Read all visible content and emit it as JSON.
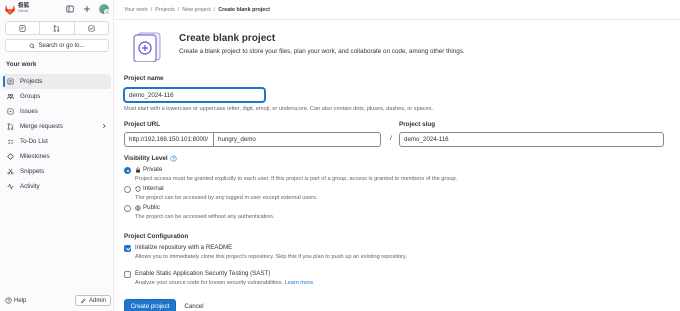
{
  "sidebar": {
    "logo_text": "极狐",
    "logo_subtext": "GitLab",
    "search_label": "Search or go to...",
    "section_title": "Your work",
    "items": [
      {
        "label": "Projects",
        "icon": "project-icon",
        "active": true
      },
      {
        "label": "Groups",
        "icon": "group-icon"
      },
      {
        "label": "Issues",
        "icon": "issues-icon"
      },
      {
        "label": "Merge requests",
        "icon": "merge-request-icon",
        "chevron": true
      },
      {
        "label": "To-Do List",
        "icon": "todo-icon"
      },
      {
        "label": "Milestones",
        "icon": "milestone-icon"
      },
      {
        "label": "Snippets",
        "icon": "snippet-icon"
      },
      {
        "label": "Activity",
        "icon": "activity-icon"
      }
    ],
    "help_label": "Help",
    "admin_label": "Admin"
  },
  "breadcrumbs": [
    "Your work",
    "Projects",
    "New project",
    "Create blank project"
  ],
  "header": {
    "title": "Create blank project",
    "description": "Create a blank project to store your files, plan your work, and collaborate on code, among other things."
  },
  "form": {
    "project_name_label": "Project name",
    "project_name_value": "demo_2024-116",
    "project_name_help": "Must start with a lowercase or uppercase letter, digit, emoji, or underscore. Can also contain dots, pluses, dashes, or spaces.",
    "project_url_label": "Project URL",
    "url_prefix": "http://192.168.150.101:8000/",
    "namespace": "hungry_demo",
    "slash": "/",
    "project_slug_label": "Project slug",
    "project_slug_value": "demo_2024-116",
    "visibility_label": "Visibility Level",
    "visibility_options": [
      {
        "label": "Private",
        "description": "Project access must be granted explicitly to each user. If this project is part of a group, access is granted to members of the group.",
        "selected": true,
        "icon": "lock-icon"
      },
      {
        "label": "Internal",
        "description": "The project can be accessed by any logged in user except external users.",
        "selected": false,
        "icon": "shield-icon"
      },
      {
        "label": "Public",
        "description": "The project can be accessed without any authentication.",
        "selected": false,
        "icon": "earth-icon"
      }
    ],
    "config_label": "Project Configuration",
    "init_readme_label": "Initialize repository with a README",
    "init_readme_desc": "Allows you to immediately clone this project's repository. Skip this if you plan to push up an existing repository.",
    "init_readme_checked": true,
    "sast_label": "Enable Static Application Security Testing (SAST)",
    "sast_desc": "Analyze your source code for known security vulnerabilities.",
    "sast_link": "Learn more.",
    "sast_checked": false,
    "create_button": "Create project",
    "cancel_button": "Cancel"
  },
  "colors": {
    "primary": "#1f75cb",
    "text": "#333238",
    "muted": "#626168",
    "logo": "#e24329"
  }
}
